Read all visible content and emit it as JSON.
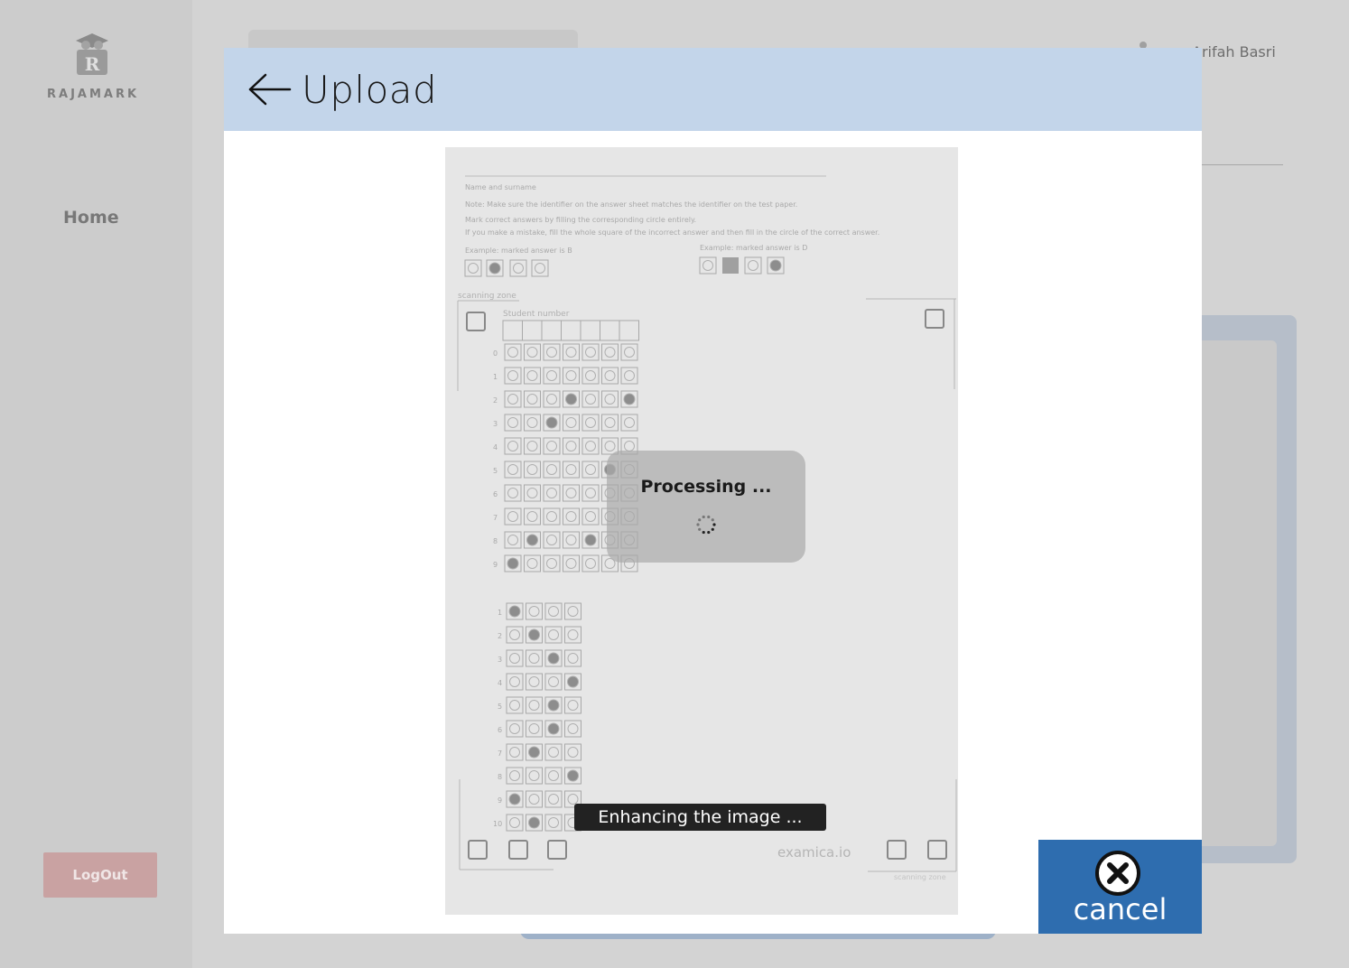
{
  "app": {
    "brand": "RAJAMARK",
    "nav_home": "Home",
    "logout_label": "LogOut",
    "user_name": "Arifah Basri"
  },
  "modal": {
    "title": "Upload",
    "processing_label": "Processing ...",
    "status_text": "Enhancing the image ...",
    "cancel_label": "cancel"
  },
  "sheet": {
    "name_label": "Name and surname",
    "note_1": "Note: Make sure the identifier on the answer sheet matches the identifier on the test paper.",
    "note_2": "Mark correct answers by filling the corresponding circle entirely.",
    "note_3": "If you make a mistake, fill the whole square of the incorrect answer and then fill in the circle of the correct answer.",
    "example_1": "Example: marked answer is B",
    "example_2": "Example: marked answer is D",
    "scanning_zone": "scanning zone",
    "student_number": "Student number",
    "footer_brand": "examica.io",
    "footer_zone": "scanning zone"
  },
  "colors": {
    "header_bg": "#c3d5ea",
    "cancel_bg": "#2e6daf",
    "logout_bg": "#c9a2a2"
  },
  "icons": [
    "back-arrow-icon",
    "spinner-icon",
    "cancel-circle-x-icon",
    "logo-owl-icon",
    "user-icon"
  ]
}
